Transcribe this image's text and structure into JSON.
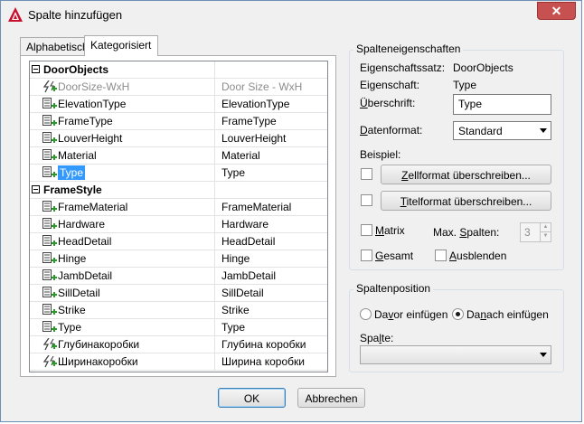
{
  "window": {
    "title": "Spalte hinzufügen",
    "close_glyph": "✕"
  },
  "tabs": [
    {
      "label": "Alphabetisch",
      "active": false
    },
    {
      "label": "Kategorisiert",
      "active": true
    }
  ],
  "tree": {
    "groups": [
      {
        "name": "DoorObjects",
        "rows": [
          {
            "name": "DoorSize-WxH",
            "value": "Door Size - WxH",
            "icon": "formula-property-icon",
            "disabled": true
          },
          {
            "name": "ElevationType",
            "value": "ElevationType",
            "icon": "add-property-icon"
          },
          {
            "name": "FrameType",
            "value": "FrameType",
            "icon": "add-property-icon"
          },
          {
            "name": "LouverHeight",
            "value": "LouverHeight",
            "icon": "add-property-icon"
          },
          {
            "name": "Material",
            "value": "Material",
            "icon": "add-property-icon"
          },
          {
            "name": "Type",
            "value": "Type",
            "icon": "add-property-icon",
            "selected": true
          }
        ]
      },
      {
        "name": "FrameStyle",
        "rows": [
          {
            "name": "FrameMaterial",
            "value": "FrameMaterial",
            "icon": "add-property-icon"
          },
          {
            "name": "Hardware",
            "value": "Hardware",
            "icon": "add-property-icon"
          },
          {
            "name": "HeadDetail",
            "value": "HeadDetail",
            "icon": "add-property-icon"
          },
          {
            "name": "Hinge",
            "value": "Hinge",
            "icon": "add-property-icon"
          },
          {
            "name": "JambDetail",
            "value": "JambDetail",
            "icon": "add-property-icon"
          },
          {
            "name": "SillDetail",
            "value": "SillDetail",
            "icon": "add-property-icon"
          },
          {
            "name": "Strike",
            "value": "Strike",
            "icon": "add-property-icon"
          },
          {
            "name": "Type",
            "value": "Type",
            "icon": "add-property-icon"
          },
          {
            "name": "Глубинакоробки",
            "value": "Глубина коробки",
            "icon": "formula-property-icon"
          },
          {
            "name": "Ширинакоробки",
            "value": "Ширина коробки",
            "icon": "formula-property-icon"
          }
        ]
      }
    ]
  },
  "column_properties": {
    "title": "Spalteneigenschaften",
    "property_set_label": "Eigenschaftssatz:",
    "property_set_value": "DoorObjects",
    "property_label": "Eigenschaft:",
    "property_value": "Type",
    "heading_label": "Überschrift:",
    "heading_value": "Type",
    "data_format_label": "Datenformat:",
    "data_format_value": "Standard",
    "example_label": "Beispiel:",
    "cell_format_button": "Zellformat überschreiben...",
    "title_format_button": "Titelformat überschreiben...",
    "matrix_label": "Matrix",
    "max_columns_label": "Max. Spalten:",
    "max_columns_value": "3",
    "total_label": "Gesamt",
    "hide_label": "Ausblenden"
  },
  "column_position": {
    "title": "Spaltenposition",
    "insert_before_label": "Davor einfügen",
    "insert_after_label": "Danach einfügen",
    "selected": "after",
    "column_label": "Spalte:",
    "column_value": ""
  },
  "buttons": {
    "ok": "OK",
    "cancel": "Abbrechen"
  },
  "colors": {
    "selection": "#3399ff",
    "accent": "#3c7fb1",
    "close": "#c75050"
  }
}
